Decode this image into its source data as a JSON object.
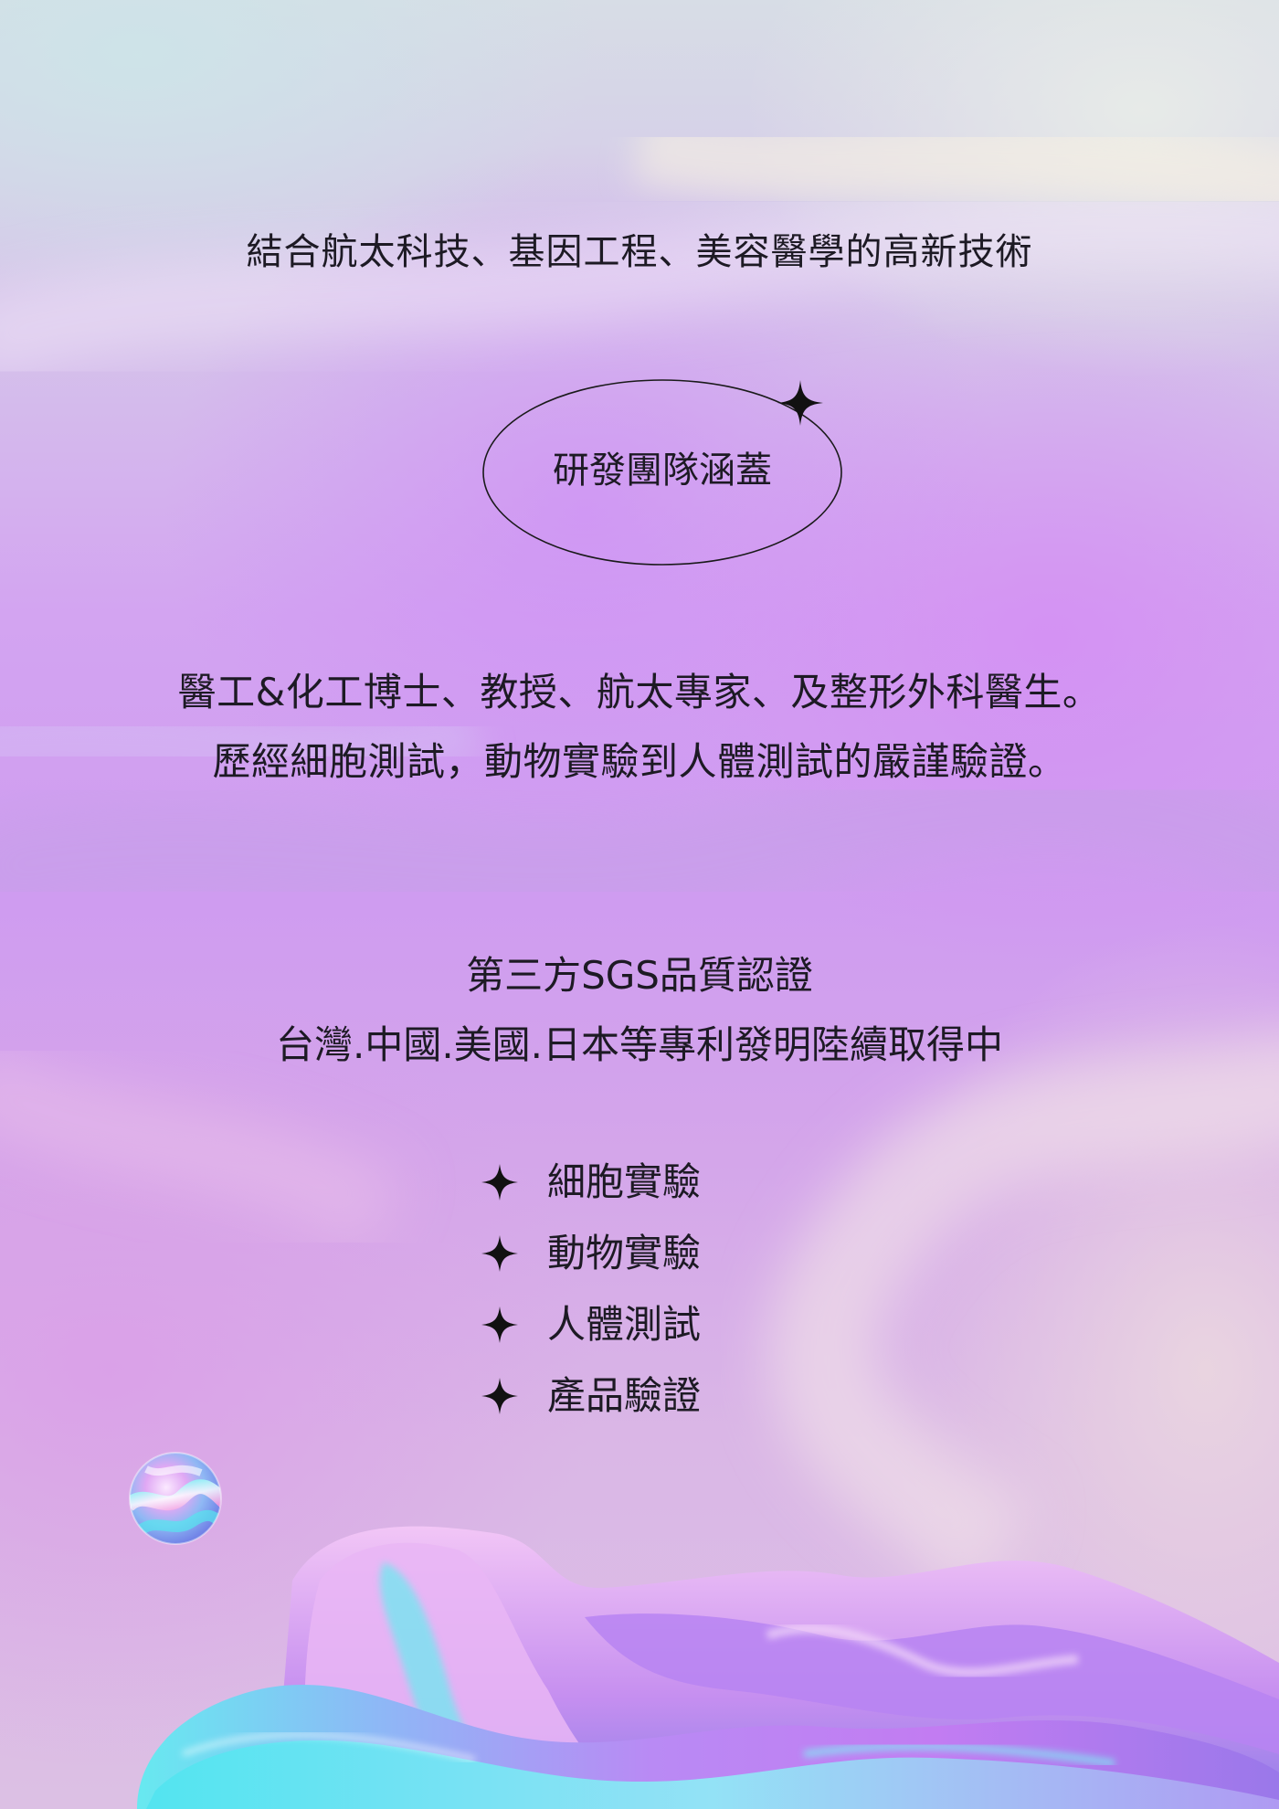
{
  "headline": "結合航太科技、基因工程、美容醫學的高新技術",
  "team_badge": {
    "label": "研發團隊涵蓋"
  },
  "team_description": {
    "line1": "醫工&化工博士、教授、航太專家、及整形外科醫生。",
    "line2": "歷經細胞測試，動物實驗到人體測試的嚴謹驗證。"
  },
  "certification": {
    "line1": "第三方SGS品質認證",
    "line2": "台灣.中國.美國.日本等專利發明陸續取得中"
  },
  "checklist": [
    {
      "icon": "four-point-star-icon",
      "label": "細胞實驗"
    },
    {
      "icon": "four-point-star-icon",
      "label": "動物實驗"
    },
    {
      "icon": "four-point-star-icon",
      "label": "人體測試"
    },
    {
      "icon": "four-point-star-icon",
      "label": "產品驗證"
    }
  ],
  "colors": {
    "text": "#1d1a24",
    "accent_purple": "#c98cf2",
    "accent_cyan": "#5fe3ee"
  }
}
